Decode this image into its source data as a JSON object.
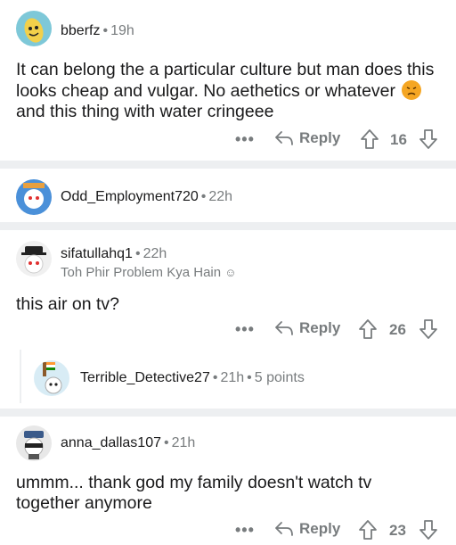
{
  "comments": [
    {
      "username": "bberfz",
      "time": "19h",
      "body_before": "It can belong the a particular culture but man does this looks cheap and vulgar. No aethetics or whatever",
      "body_after": "and this thing with water cringeee",
      "emoji": "angry-face-icon",
      "reply_label": "Reply",
      "score": "16"
    },
    {
      "username": "Odd_Employment720",
      "time": "22h"
    },
    {
      "username": "sifatullahq1",
      "time": "22h",
      "flair": "Toh Phir Problem Kya Hain",
      "body": "this air on tv?",
      "reply_label": "Reply",
      "score": "26"
    },
    {
      "username": "Terrible_Detective27",
      "time": "21h",
      "points": "5 points"
    },
    {
      "username": "anna_dallas107",
      "time": "21h",
      "body": "ummm... thank god my family doesn't watch tv together anymore",
      "reply_label": "Reply",
      "score": "23"
    }
  ],
  "more_label": "•••",
  "separator": "•",
  "colors": {
    "divider": "#edeff1",
    "meta": "#787c7e",
    "text": "#1a1a1b",
    "emoji": "#f5a623"
  }
}
